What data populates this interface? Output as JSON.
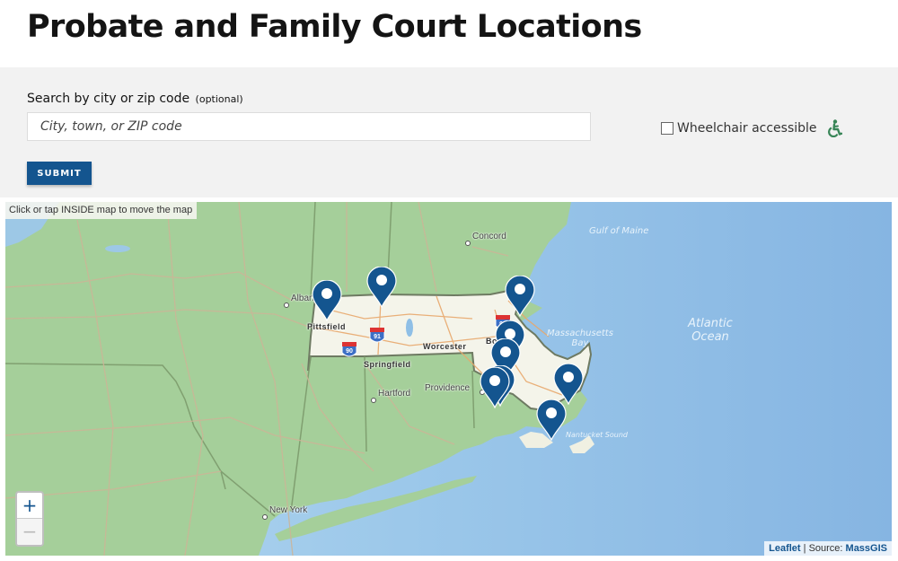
{
  "page": {
    "title": "Probate and Family Court Locations"
  },
  "search": {
    "label": "Search by city or zip code",
    "optional_label": "(optional)",
    "placeholder": "City, town, or ZIP code",
    "value": "",
    "submit_label": "SUBMIT",
    "wheelchair_label": "Wheelchair accessible",
    "wheelchair_checked": false
  },
  "map": {
    "hint": "Click or tap INSIDE map to move the map",
    "zoom_in_label": "+",
    "zoom_out_label": "−",
    "attribution": {
      "leaflet": "Leaflet",
      "separator": " | Source: ",
      "source": "MassGIS"
    },
    "city_labels": {
      "concord": "Concord",
      "albany": "Albany",
      "pittsfield": "Pittsfield",
      "springfield": "Springfield",
      "worcester": "Worcester",
      "boston": "Boston",
      "hartford": "Hartford",
      "providence": "Providence",
      "new_york": "New York"
    },
    "water_labels": {
      "gulf_of_maine": "Gulf of Maine",
      "massachusetts_bay_1": "Massachusetts",
      "massachusetts_bay_2": "Bay",
      "atlantic_1": "Atlantic",
      "atlantic_2": "Ocean",
      "nantucket_sound": "Nantucket Sound"
    },
    "highway_shields": [
      "90",
      "91",
      "93"
    ],
    "marker_count": 9,
    "colors": {
      "marker": "#14558f",
      "land": "#a5cf9a",
      "water": "#8fbfe6",
      "massachusetts": "#f4f4ea"
    }
  }
}
